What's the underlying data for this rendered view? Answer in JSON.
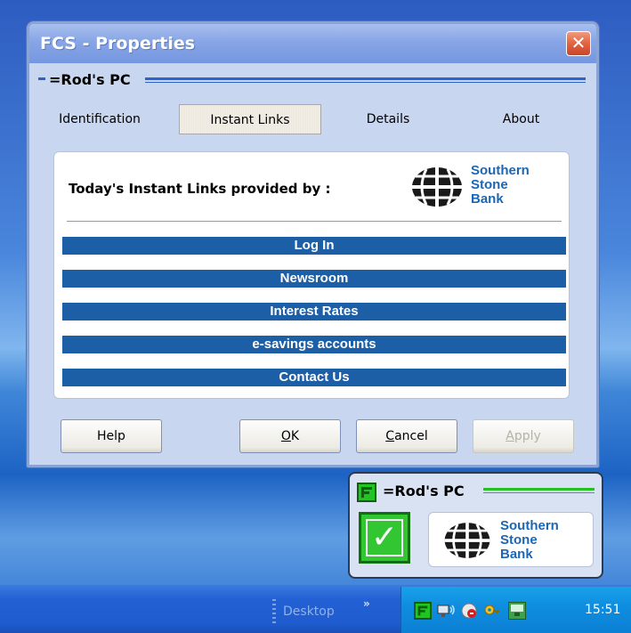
{
  "window": {
    "title": "FCS - Properties",
    "close_glyph": "✕"
  },
  "section": {
    "label": "=Rod's PC"
  },
  "tabs": [
    {
      "label": "Identification",
      "active": false
    },
    {
      "label": "Instant Links",
      "active": true
    },
    {
      "label": "Details",
      "active": false
    },
    {
      "label": "About",
      "active": false
    }
  ],
  "panel": {
    "provided_by": "Today's Instant Links provided by :",
    "logo": {
      "line1": "Southern",
      "line2": "Stone",
      "line3": "Bank",
      "color": "#1d66b3"
    },
    "links": [
      "Log In",
      "Newsroom",
      "Interest Rates",
      "e-savings accounts",
      "Contact Us"
    ],
    "link_color": "#1d5fa7"
  },
  "buttons": {
    "help": "Help",
    "ok_prefix": "",
    "ok_ul": "O",
    "ok_rest": "K",
    "cancel_ul": "C",
    "cancel_rest": "ancel",
    "apply_ul": "A",
    "apply_rest": "pply"
  },
  "widget": {
    "label": "=Rod's PC",
    "check_glyph": "✓",
    "logo": {
      "line1": "Southern",
      "line2": "Stone",
      "line3": "Bank"
    },
    "accent": "#25c225"
  },
  "taskbar": {
    "desktop_label": "Desktop",
    "chevron": "»",
    "clock": "15:51",
    "tray_icons": [
      "fcs-icon",
      "network-icon",
      "security-icon",
      "key-icon",
      "lan-icon"
    ]
  }
}
